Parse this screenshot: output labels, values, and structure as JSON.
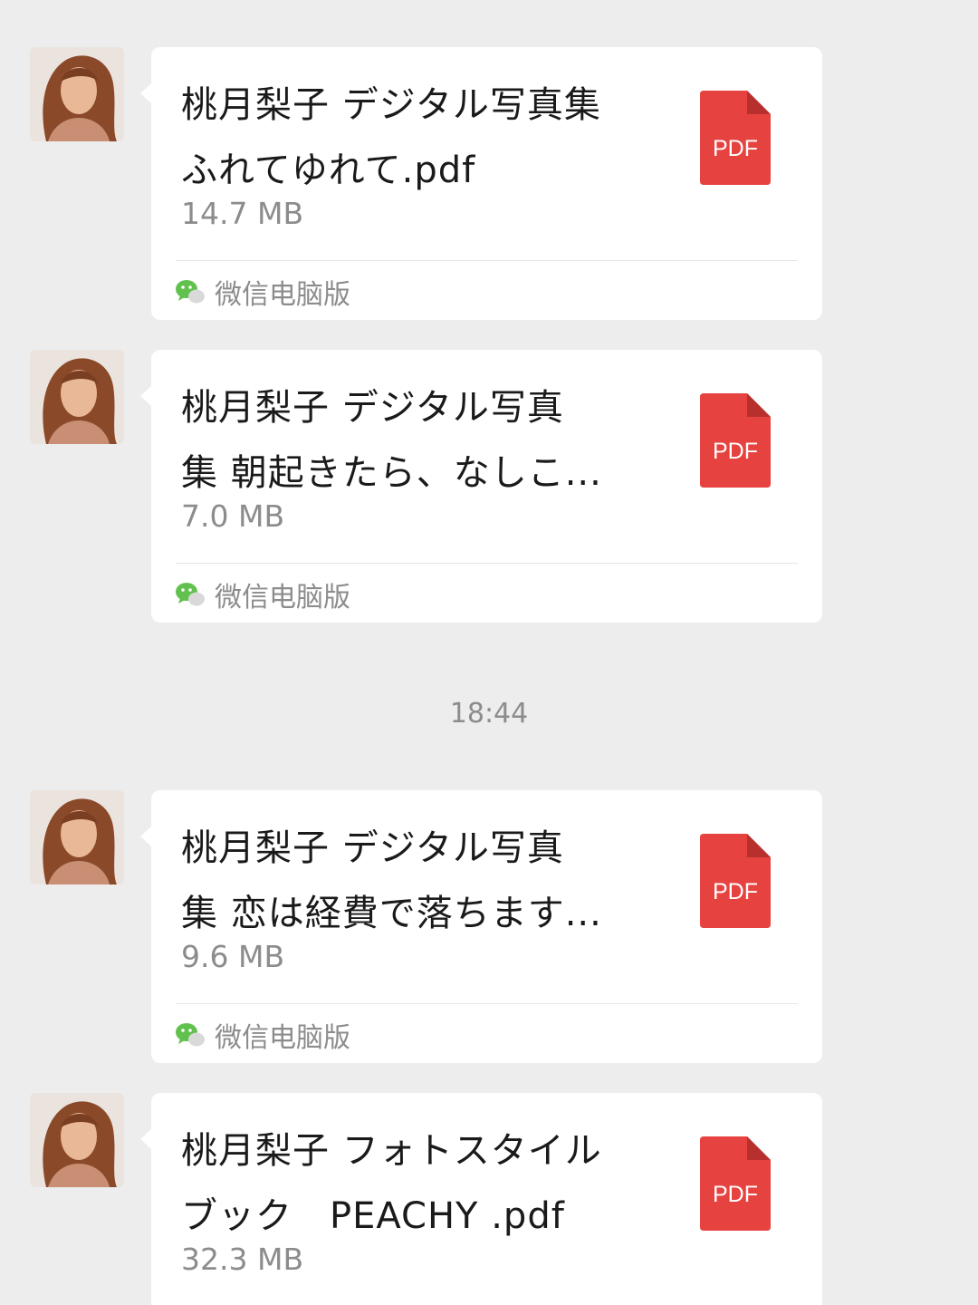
{
  "messages": [
    {
      "title_line1": "桃月梨子 デジタル写真集",
      "title_line2": "ふれてゆれて.pdf",
      "size": "14.7 MB",
      "file_type": "PDF",
      "source": "微信电脑版"
    },
    {
      "title_line1": "桃月梨子 デジタル写真",
      "title_line2": "集 朝起きたら、なしこ...",
      "size": "7.0 MB",
      "file_type": "PDF",
      "source": "微信电脑版"
    },
    {
      "title_line1": "桃月梨子 デジタル写真",
      "title_line2": "集 恋は経費で落ちます...",
      "size": "9.6 MB",
      "file_type": "PDF",
      "source": "微信电脑版"
    },
    {
      "title_line1": "桃月梨子 フォトスタイル",
      "title_line2": "ブック　PEACHY .pdf",
      "size": "32.3 MB",
      "file_type": "PDF",
      "source": ""
    }
  ],
  "timestamp": "18:44",
  "colors": {
    "background": "#ededed",
    "bubble": "#ffffff",
    "pdf_red": "#e64340",
    "wechat_green": "#62c14e",
    "muted_text": "#8c8c8c"
  },
  "icons": {
    "file": "pdf-file-icon",
    "source": "wechat-logo-icon"
  }
}
